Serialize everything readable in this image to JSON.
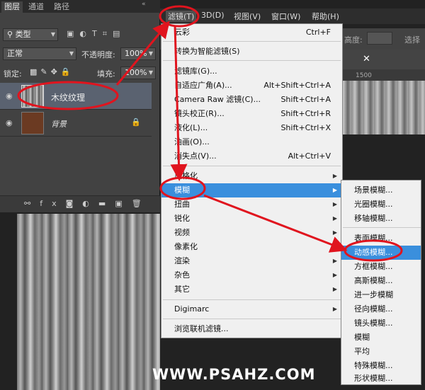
{
  "layers_panel": {
    "tabs": [
      "图层",
      "通道",
      "路径"
    ],
    "filter_kind": "类型",
    "blend_mode": "正常",
    "opacity_label": "不透明度:",
    "opacity_value": "100%",
    "lock_label": "锁定:",
    "fill_label": "填充:",
    "fill_value": "100%",
    "layers": [
      {
        "name": "木纹纹理"
      },
      {
        "name": "背景"
      }
    ]
  },
  "menubar": {
    "items": [
      "滤镜(T)",
      "3D(D)",
      "视图(V)",
      "窗口(W)",
      "帮助(H)"
    ]
  },
  "options_bar": {
    "height_label": "高度:",
    "right_text": "选择"
  },
  "ruler": {
    "label": "1500"
  },
  "filter_menu": {
    "items": [
      {
        "label": "云彩",
        "shortcut": "Ctrl+F"
      },
      {
        "label": "转换为智能滤镜(S)",
        "shortcut": ""
      },
      {
        "label": "滤镜库(G)...",
        "shortcut": ""
      },
      {
        "label": "自适应广角(A)...",
        "shortcut": "Alt+Shift+Ctrl+A"
      },
      {
        "label": "Camera Raw 滤镜(C)...",
        "shortcut": "Shift+Ctrl+A"
      },
      {
        "label": "镜头校正(R)...",
        "shortcut": "Shift+Ctrl+R"
      },
      {
        "label": "液化(L)...",
        "shortcut": "Shift+Ctrl+X"
      },
      {
        "label": "油画(O)...",
        "shortcut": ""
      },
      {
        "label": "消失点(V)...",
        "shortcut": "Alt+Ctrl+V"
      },
      {
        "label": "风格化",
        "shortcut": ""
      },
      {
        "label": "模糊",
        "shortcut": ""
      },
      {
        "label": "扭曲",
        "shortcut": ""
      },
      {
        "label": "锐化",
        "shortcut": ""
      },
      {
        "label": "视频",
        "shortcut": ""
      },
      {
        "label": "像素化",
        "shortcut": ""
      },
      {
        "label": "渲染",
        "shortcut": ""
      },
      {
        "label": "杂色",
        "shortcut": ""
      },
      {
        "label": "其它",
        "shortcut": ""
      },
      {
        "label": "Digimarc",
        "shortcut": ""
      },
      {
        "label": "浏览联机滤镜...",
        "shortcut": ""
      }
    ]
  },
  "blur_submenu": {
    "items": [
      "场景模糊...",
      "光圈模糊...",
      "移轴模糊...",
      "表面模糊...",
      "动感模糊...",
      "方框模糊...",
      "高斯模糊...",
      "进一步模糊",
      "径向模糊...",
      "镜头模糊...",
      "模糊",
      "平均",
      "特殊模糊...",
      "形状模糊..."
    ]
  },
  "watermark": "WWW.PSAHZ.COM",
  "colors": {
    "highlight": "#3a8fdd",
    "annotation": "#e0141e"
  }
}
